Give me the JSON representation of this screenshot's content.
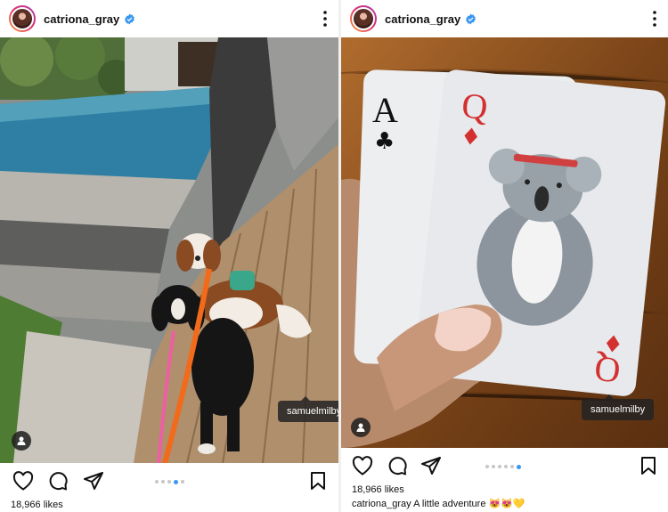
{
  "posts": [
    {
      "username": "catriona_gray",
      "tag": "samuelmilby",
      "likes": "18,966 likes",
      "dots": 5,
      "active_dot": 3
    },
    {
      "username": "catriona_gray",
      "tag": "samuelmilby",
      "likes": "18,966 likes",
      "caption_user": "catriona_gray",
      "caption_text": "A little adventure 😻😻💛",
      "dots": 6,
      "active_dot": 5
    }
  ],
  "colors": {
    "verified": "#3897f0",
    "active_dot": "#3897f0"
  }
}
